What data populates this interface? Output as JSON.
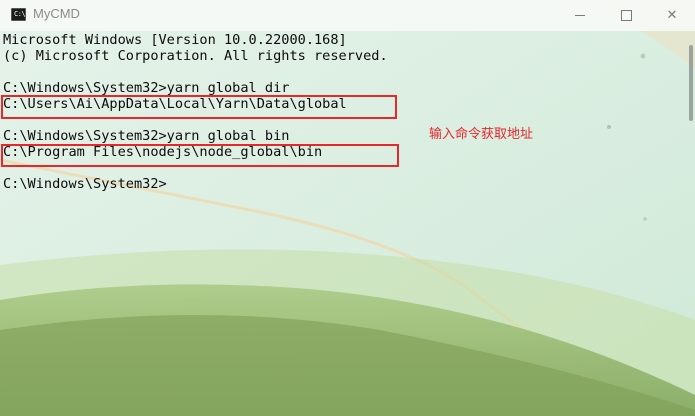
{
  "window": {
    "title": "MyCMD",
    "app_icon": "cmd-icon",
    "app_icon_text": "C:\\",
    "controls": [
      "minimize-icon",
      "maximize-icon",
      "close-icon"
    ],
    "close_glyph": "✕"
  },
  "console": {
    "lines": [
      "Microsoft Windows [Version 10.0.22000.168]",
      "(c) Microsoft Corporation. All rights reserved.",
      "",
      "C:\\Windows\\System32>yarn global dir",
      "C:\\Users\\Ai\\AppData\\Local\\Yarn\\Data\\global",
      "",
      "C:\\Windows\\System32>yarn global bin",
      "C:\\Program Files\\nodejs\\node_global\\bin",
      "",
      "C:\\Windows\\System32>"
    ],
    "text_color": "#0c0c0c"
  },
  "annotation": {
    "text": "输入命令获取地址",
    "color": "#e8262b"
  }
}
